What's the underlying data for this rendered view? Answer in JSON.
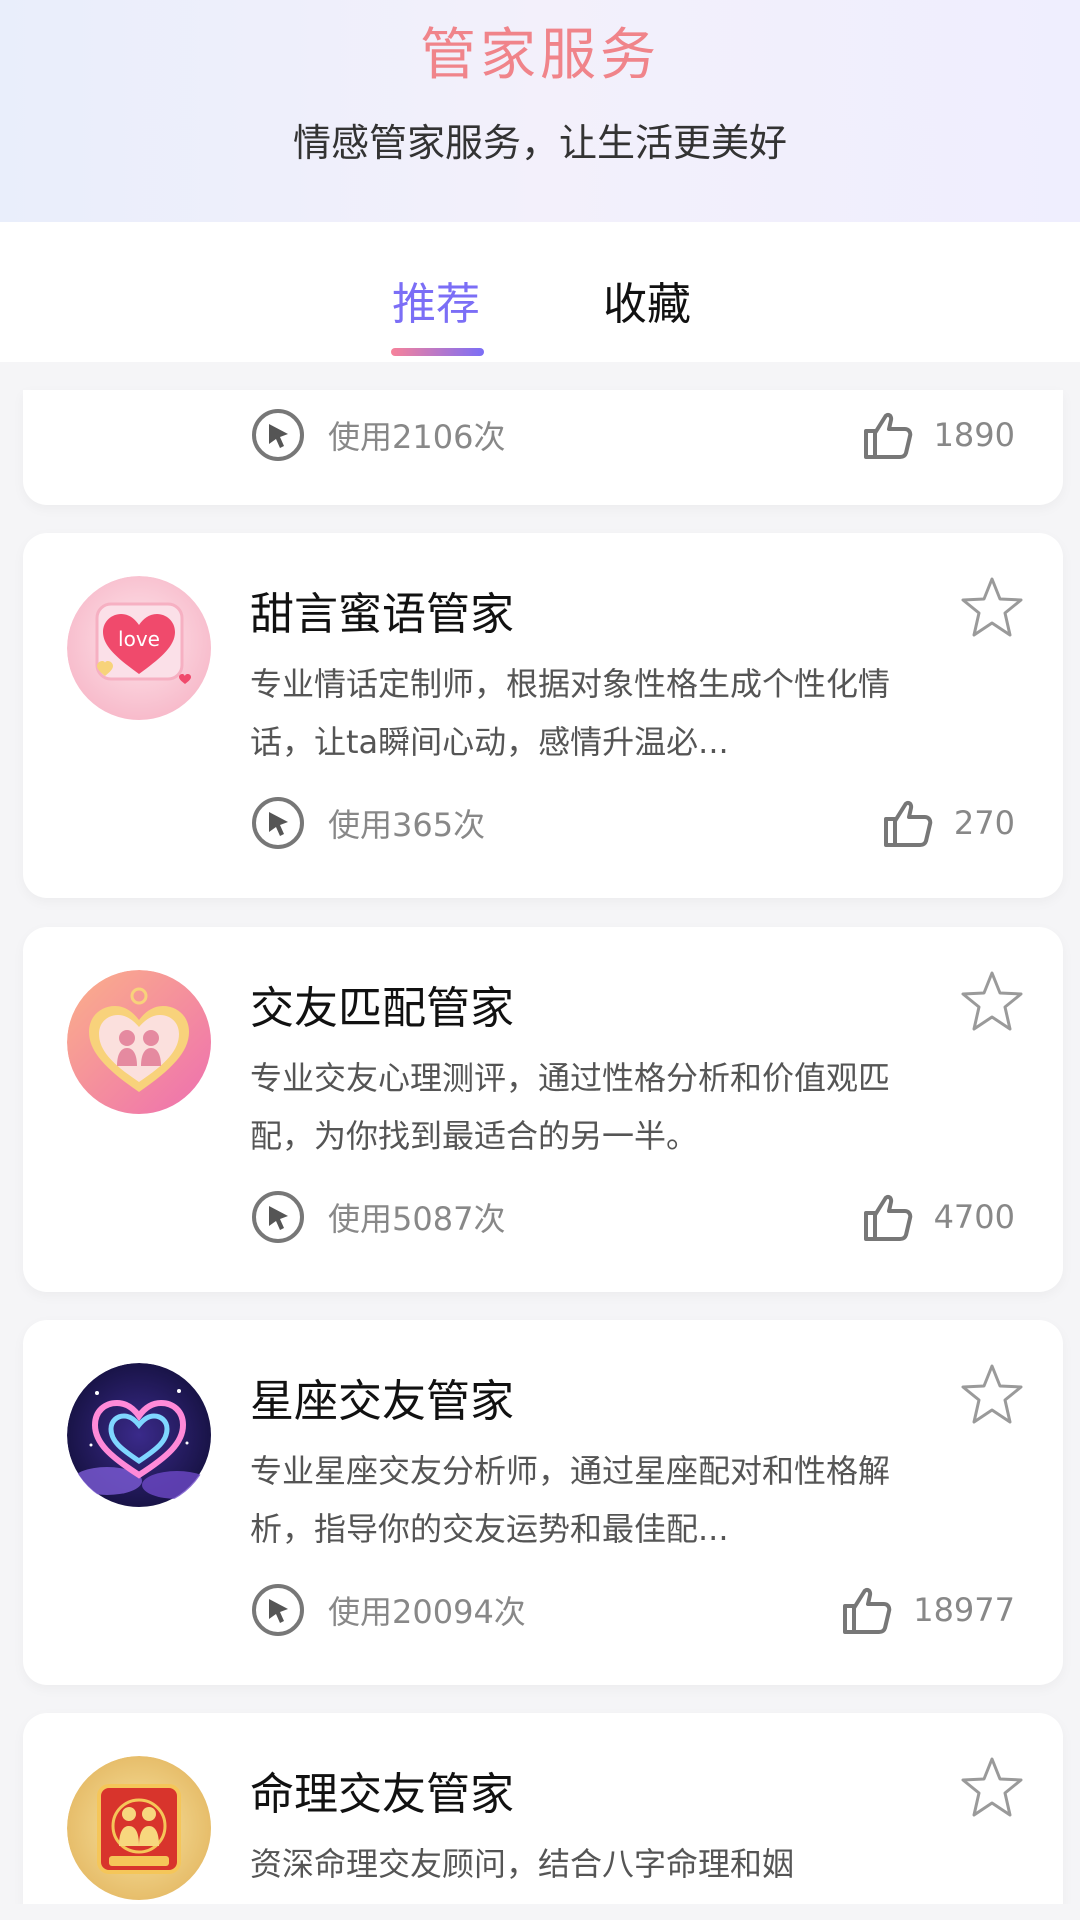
{
  "header": {
    "title": "管家服务",
    "subtitle": "情感管家服务，让生活更美好"
  },
  "tabs": [
    {
      "label": "推荐",
      "active": true
    },
    {
      "label": "收藏",
      "active": false
    }
  ],
  "cards": [
    {
      "title": "",
      "description": "",
      "usage": "使用2106次",
      "likes": "1890",
      "partial": true
    },
    {
      "title": "甜言蜜语管家",
      "description": "专业情话定制师，根据对象性格生成个性化情话，让ta瞬间心动，感情升温必...",
      "usage": "使用365次",
      "likes": "270",
      "avatar_icon": "love-heart-icon",
      "avatar_text": "love"
    },
    {
      "title": "交友匹配管家",
      "description": "专业交友心理测评，通过性格分析和价值观匹配，为你找到最适合的另一半。",
      "usage": "使用5087次",
      "likes": "4700",
      "avatar_icon": "couple-heart-icon"
    },
    {
      "title": "星座交友管家",
      "description": "专业星座交友分析师，通过星座配对和性格解析，指导你的交友运势和最佳配...",
      "usage": "使用20094次",
      "likes": "18977",
      "avatar_icon": "glowing-heart-icon"
    },
    {
      "title": "命理交友管家",
      "description": "资深命理交友顾问，结合八字命理和姻",
      "avatar_icon": "fortune-couple-icon"
    }
  ],
  "colors": {
    "accent": "#7b6ef6",
    "title_pink": "#f0848a"
  }
}
